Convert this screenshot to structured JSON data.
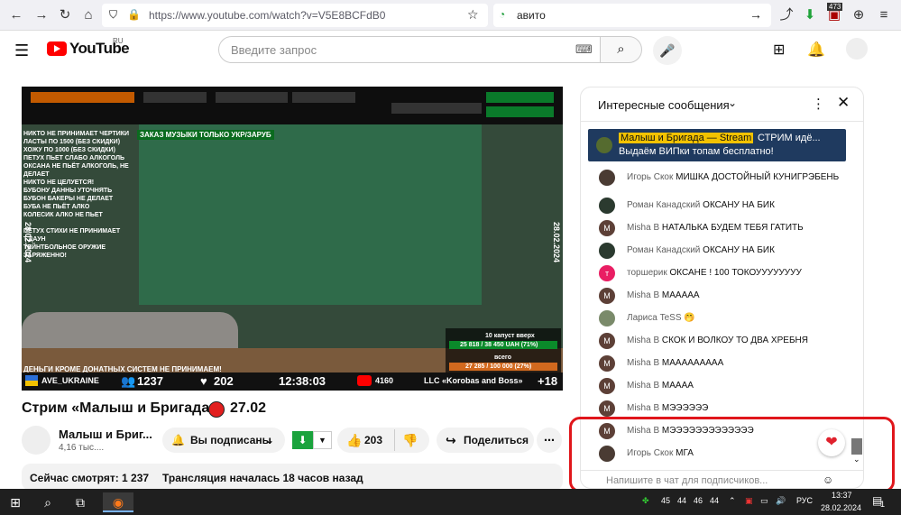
{
  "browser": {
    "url": "https://www.youtube.com/watch?v=V5E8BCFdB0",
    "search_value": "авито",
    "ext_badge": "473"
  },
  "youtube": {
    "logo_text": "YouTube",
    "logo_region": "RU",
    "search_placeholder": "Введите запрос"
  },
  "video": {
    "overlay_green_banner": "ЗАКАЗ МУЗЫКИ ТОЛЬКО УКР/ЗАРУБ",
    "overlay_left_lines": [
      "НИКТО НЕ ПРИНИМАЕТ ЧЕРТИКИ",
      "ЛАСТЫ ПО 1500 (БЕЗ СКИДКИ)",
      "ХОЖУ ПО 1000 (БЕЗ СКИДКИ)",
      "ПЕТУХ ПЬЕТ СЛАБО АЛКОГОЛЬ",
      "ОКСАНА НЕ ПЬЁТ АЛКОГОЛЬ, НЕ ДЕЛАЕТ",
      "НИКТО НЕ ЦЕЛУЕТСЯ!",
      "БУБОНУ ДАННЫ УТОЧНЯТЬ",
      "БУБОН БАКЕРЫ НЕ ДЕЛАЕТ",
      "БУБА НЕ ПЬЁТ АЛКО",
      "КОЛЕСИК АЛКО НЕ ПЬЕТ",
      "",
      "ПЕТУХ СТИХИ НЕ ПРИНИМАЕТ Т.ДАУН",
      "ТЕЙНТБОЛЬНОЕ ОРУЖИЕ ЗАРЯЖЕННО!"
    ],
    "date_side": "28.02.2024",
    "bottom_banner": "ДЕНЬГИ КРОМЕ ДОНАТНЫХ СИСТЕМ НЕ ПРИНИМАЕМ!",
    "channel_tag": "AVE_UKRAINE",
    "viewers": "1237",
    "likes": "202",
    "timer": "12:38:03",
    "yt_count": "4160",
    "credit": "LLC «Korobas and Boss»",
    "age": "+18",
    "donation_box": {
      "label": "10 капуст вверх",
      "amount": "25 818 / 38 450 UAH (71%)",
      "total_label": "всего",
      "total": "27 285 / 100 000 (27%)"
    }
  },
  "page": {
    "title_part1": "Стрим «Малыш и Бригада»",
    "title_part2": "27.02",
    "channel_name": "Малыш и Бриг...",
    "channel_subs": "4,16 тыс....",
    "subscribed_label": "Вы подписаны",
    "like_count": "203",
    "share_label": "Поделиться",
    "watching_label": "Сейчас смотрят: 1 237",
    "started_label": "Трансляция началась 18 часов назад"
  },
  "chat": {
    "header": "Интересные сообщения",
    "pinned_author": "Малыш и Бригада — Stream",
    "pinned_text": "СТРИМ идё...",
    "pinned_text2": "Выдаём ВИПки топам бесплатно!",
    "input_placeholder": "Напишите в чат для подписчиков...",
    "messages": [
      {
        "author": "Игорь Скок",
        "text": "МИШКА ДОСТОЙНЫЙ КУНИГРЭБЕНЬ",
        "avatar": "",
        "color": "#4a3b33"
      },
      {
        "author": "Роман Канадский",
        "text": "ОКСАНУ НА БИК",
        "avatar": "",
        "color": "#2b3a2f"
      },
      {
        "author": "Misha B",
        "text": "НАТАЛЬКА БУДЕМ ТЕБЯ ГАТИТЬ",
        "avatar": "M",
        "color": "#5d4037"
      },
      {
        "author": "Роман Канадский",
        "text": "ОКСАНУ НА БИК",
        "avatar": "",
        "color": "#2b3a2f"
      },
      {
        "author": "торшерик",
        "text": "ОКСАНЕ ! 100 ТОКОУУУУУУУУ",
        "avatar": "т",
        "color": "#e91e63"
      },
      {
        "author": "Misha B",
        "text": "МААААА",
        "avatar": "M",
        "color": "#5d4037"
      },
      {
        "author": "Лариса TeSS",
        "text": "🤭",
        "avatar": "",
        "color": "#7a8a6a"
      },
      {
        "author": "Misha B",
        "text": "СКОК И ВОЛКОУ ТО ДВА ХРЕБНЯ",
        "avatar": "M",
        "color": "#5d4037"
      },
      {
        "author": "Misha B",
        "text": "МААААААААА",
        "avatar": "M",
        "color": "#5d4037"
      },
      {
        "author": "Misha B",
        "text": "МАААА",
        "avatar": "M",
        "color": "#5d4037"
      },
      {
        "author": "Misha B",
        "text": "МЭЭЭЭЭЭ",
        "avatar": "M",
        "color": "#5d4037"
      },
      {
        "author": "Misha B",
        "text": "МЭЭЭЭЭЭЭЭЭЭЭЭЭ",
        "avatar": "M",
        "color": "#5d4037"
      },
      {
        "author": "Игорь Скок",
        "text": "МГА",
        "avatar": "",
        "color": "#4a3b33"
      }
    ]
  },
  "taskbar": {
    "tray_numbers": [
      "45",
      "44",
      "46",
      "44"
    ],
    "lang": "РУС",
    "time": "13:37",
    "date": "28.02.2024",
    "notif_count": "1"
  },
  "colors": {
    "yt_red": "#ff0000",
    "highlight": "#e0161b",
    "pinned_bg": "#1f3a5f",
    "taskbar_bg": "#1f1f1f"
  }
}
